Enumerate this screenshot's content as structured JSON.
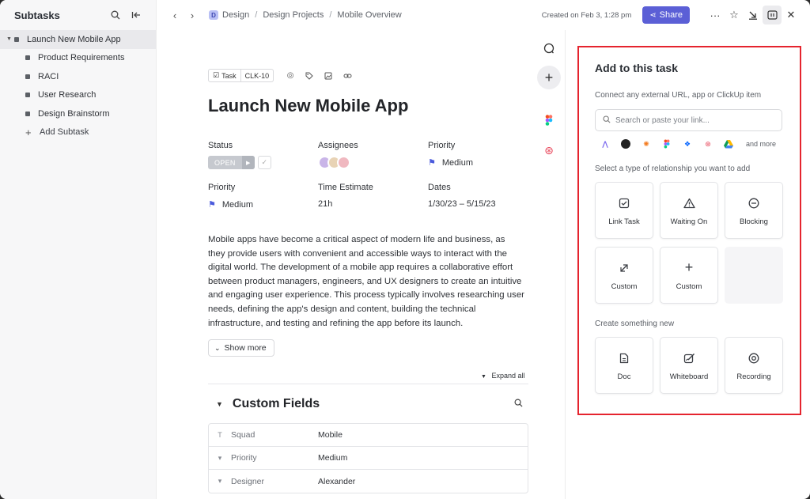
{
  "sidebar": {
    "title": "Subtasks",
    "parent": "Launch New Mobile App",
    "items": [
      {
        "label": "Product Requirements"
      },
      {
        "label": "RACI"
      },
      {
        "label": "User Research"
      },
      {
        "label": "Design Brainstorm"
      }
    ],
    "add_label": "Add Subtask"
  },
  "topbar": {
    "breadcrumb_badge": "D",
    "breadcrumbs": [
      "Design",
      "Design Projects",
      "Mobile Overview"
    ],
    "created": "Created on Feb 3, 1:28 pm",
    "share_label": "Share"
  },
  "task": {
    "type_chip": "Task",
    "id_chip": "CLK-10",
    "title": "Launch New Mobile App",
    "fields": {
      "status_label": "Status",
      "status_value": "OPEN",
      "assignees_label": "Assignees",
      "priority_label": "Priority",
      "priority_value": "Medium",
      "priority2_label": "Priority",
      "priority2_value": "Medium",
      "time_label": "Time Estimate",
      "time_value": "21h",
      "dates_label": "Dates",
      "dates_value": "1/30/23 – 5/15/23"
    },
    "description": "Mobile apps have become a critical aspect of modern life and business, as they provide users with convenient and accessible ways to interact with the digital world. The development of a mobile app requires a collaborative effort between product managers, engineers, and UX designers to create an intuitive and engaging user experience. This process typically involves researching user needs, defining the app's design and content, building the technical infrastructure, and testing and refining the app before its launch.",
    "show_more": "Show more",
    "expand_all": "Expand all",
    "custom_fields_title": "Custom Fields",
    "custom_fields": [
      {
        "name": "Squad",
        "value": "Mobile",
        "icon": "T"
      },
      {
        "name": "Priority",
        "value": "Medium",
        "icon": "▾"
      },
      {
        "name": "Designer",
        "value": "Alexander",
        "icon": "▾"
      }
    ]
  },
  "panel": {
    "title": "Add to this task",
    "connect_text": "Connect any external URL, app or ClickUp item",
    "search_placeholder": "Search or paste your link...",
    "and_more": "and more",
    "relationship_text": "Select a type of relationship you want to add",
    "relationships": [
      {
        "label": "Link Task",
        "icon": "check-square-icon"
      },
      {
        "label": "Waiting On",
        "icon": "warning-icon"
      },
      {
        "label": "Blocking",
        "icon": "minus-circle-icon"
      },
      {
        "label": "Custom",
        "icon": "arrows-icon"
      },
      {
        "label": "Custom",
        "icon": "plus-icon"
      }
    ],
    "create_text": "Create something new",
    "create_items": [
      {
        "label": "Doc",
        "icon": "doc-icon"
      },
      {
        "label": "Whiteboard",
        "icon": "whiteboard-icon"
      },
      {
        "label": "Recording",
        "icon": "record-icon"
      }
    ]
  },
  "colors": {
    "accent": "#5b5fd6",
    "highlight_border": "#e5242e",
    "priority_flag": "#4b5bdc"
  }
}
